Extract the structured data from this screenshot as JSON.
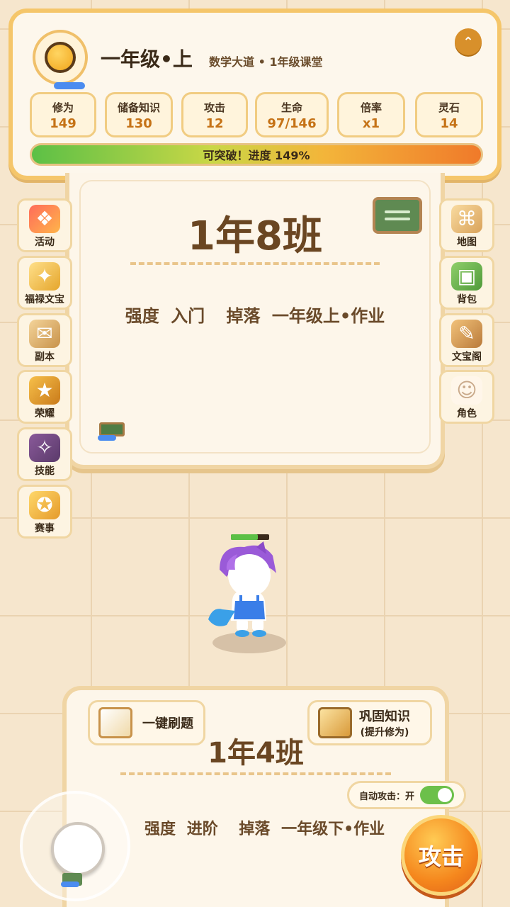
{
  "header": {
    "grade_title": "一年级•上",
    "subtitle": "数学大道 • 1年级课堂",
    "collapse_icon": "chevron-up-icon",
    "stats": [
      {
        "label": "修为",
        "value": "149"
      },
      {
        "label": "储备知识",
        "value": "130"
      },
      {
        "label": "攻击",
        "value": "12"
      },
      {
        "label": "生命",
        "value": "97/146"
      },
      {
        "label": "倍率",
        "value": "x1"
      },
      {
        "label": "灵石",
        "value": "14"
      }
    ],
    "progress_text": "可突破！进度 149%",
    "progress_percent": 149
  },
  "top_card": {
    "class_name": "1年8班",
    "strength_label": "强度",
    "strength_value": "入门",
    "drop_label": "掉落",
    "drop_value": "一年级上•作业"
  },
  "left_menu": [
    {
      "label": "活动",
      "icon": "gift-icon"
    },
    {
      "label": "福禄文宝",
      "icon": "golden-treasure-icon"
    },
    {
      "label": "副本",
      "icon": "scroll-icon"
    },
    {
      "label": "荣耀",
      "icon": "shield-medal-icon"
    },
    {
      "label": "技能",
      "icon": "skill-book-icon"
    },
    {
      "label": "赛事",
      "icon": "trophy-medal-icon"
    }
  ],
  "right_menu": [
    {
      "label": "地图",
      "icon": "map-icon"
    },
    {
      "label": "背包",
      "icon": "backpack-icon"
    },
    {
      "label": "文宝阁",
      "icon": "treasure-book-icon"
    },
    {
      "label": "角色",
      "icon": "character-icon"
    }
  ],
  "character": {
    "hp_fraction": 0.7
  },
  "bottom_card": {
    "quick_brush_label": "一键刷题",
    "consolidate_label": "巩固知识",
    "consolidate_sub": "(提升修为)",
    "class_name": "1年4班",
    "auto_attack_label": "自动攻击：开",
    "auto_attack_on": true,
    "strength_label": "强度",
    "strength_value": "进阶",
    "drop_label": "掉落",
    "drop_value": "一年级下•作业"
  },
  "attack_label": "攻击",
  "colors": {
    "accent": "#f5c66a",
    "background": "#f6e6cd",
    "progress_start": "#5cc046",
    "progress_end": "#f07a2a",
    "attack": "#f5871d"
  }
}
